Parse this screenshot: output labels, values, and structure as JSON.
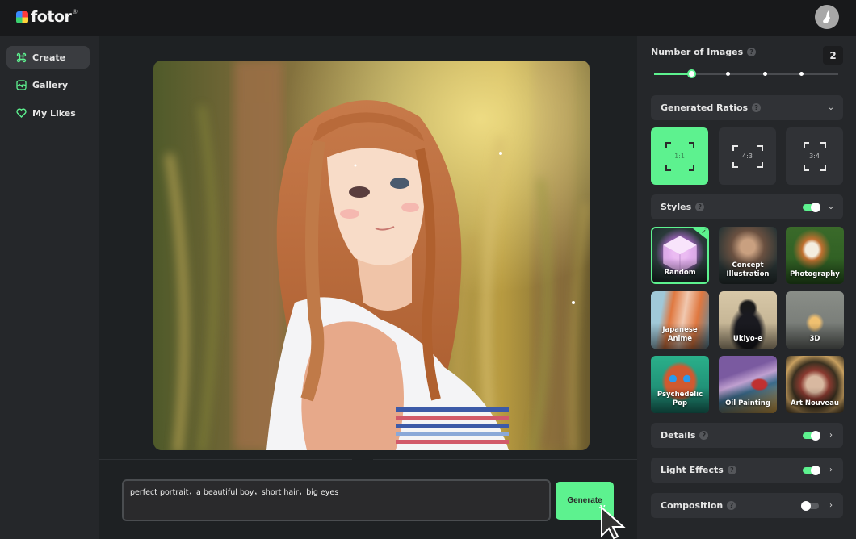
{
  "app": {
    "brand": "fotor",
    "brand_mark": "®",
    "avatar_icon": "user-avatar-icon"
  },
  "sidebar": {
    "items": [
      {
        "label": "Create",
        "icon": "command-icon",
        "active": true
      },
      {
        "label": "Gallery",
        "icon": "gallery-icon",
        "active": false
      },
      {
        "label": "My Likes",
        "icon": "heart-icon",
        "active": false
      }
    ]
  },
  "main": {
    "image_alt": "Generated anime portrait of a girl with long auburn hair in a sunlit field",
    "prompt_value": "perfect portrait，a beautiful boy，short hair，big eyes",
    "generate_label": "Generate"
  },
  "panel": {
    "number_of_images": {
      "label": "Number of Images",
      "help": "?",
      "value": "2",
      "steps": [
        1,
        2,
        3,
        4,
        5
      ],
      "selected_step_index": 1
    },
    "ratios": {
      "label": "Generated Ratios",
      "help": "?",
      "options": [
        {
          "label": "1:1",
          "selected": true
        },
        {
          "label": "4:3",
          "selected": false
        },
        {
          "label": "3:4",
          "selected": false
        }
      ]
    },
    "styles": {
      "label": "Styles",
      "help": "?",
      "enabled": true,
      "items": [
        {
          "label": "Random",
          "selected": true
        },
        {
          "label": "Concept Illustration",
          "selected": false
        },
        {
          "label": "Photography",
          "selected": false
        },
        {
          "label": "Japanese Anime",
          "selected": false
        },
        {
          "label": "Ukiyo-e",
          "selected": false
        },
        {
          "label": "3D",
          "selected": false
        },
        {
          "label": "Psychedelic Pop",
          "selected": false
        },
        {
          "label": "Oil Painting",
          "selected": false
        },
        {
          "label": "Art Nouveau",
          "selected": false
        }
      ]
    },
    "details": {
      "label": "Details",
      "help": "?",
      "enabled": true
    },
    "light_effects": {
      "label": "Light Effects",
      "help": "?",
      "enabled": true
    },
    "composition": {
      "label": "Composition",
      "help": "?",
      "enabled": false
    }
  },
  "colors": {
    "accent": "#5df28f",
    "topbar": "#18191b",
    "sidebar": "#25272a",
    "main_bg": "#1e2123",
    "card": "#303236"
  }
}
